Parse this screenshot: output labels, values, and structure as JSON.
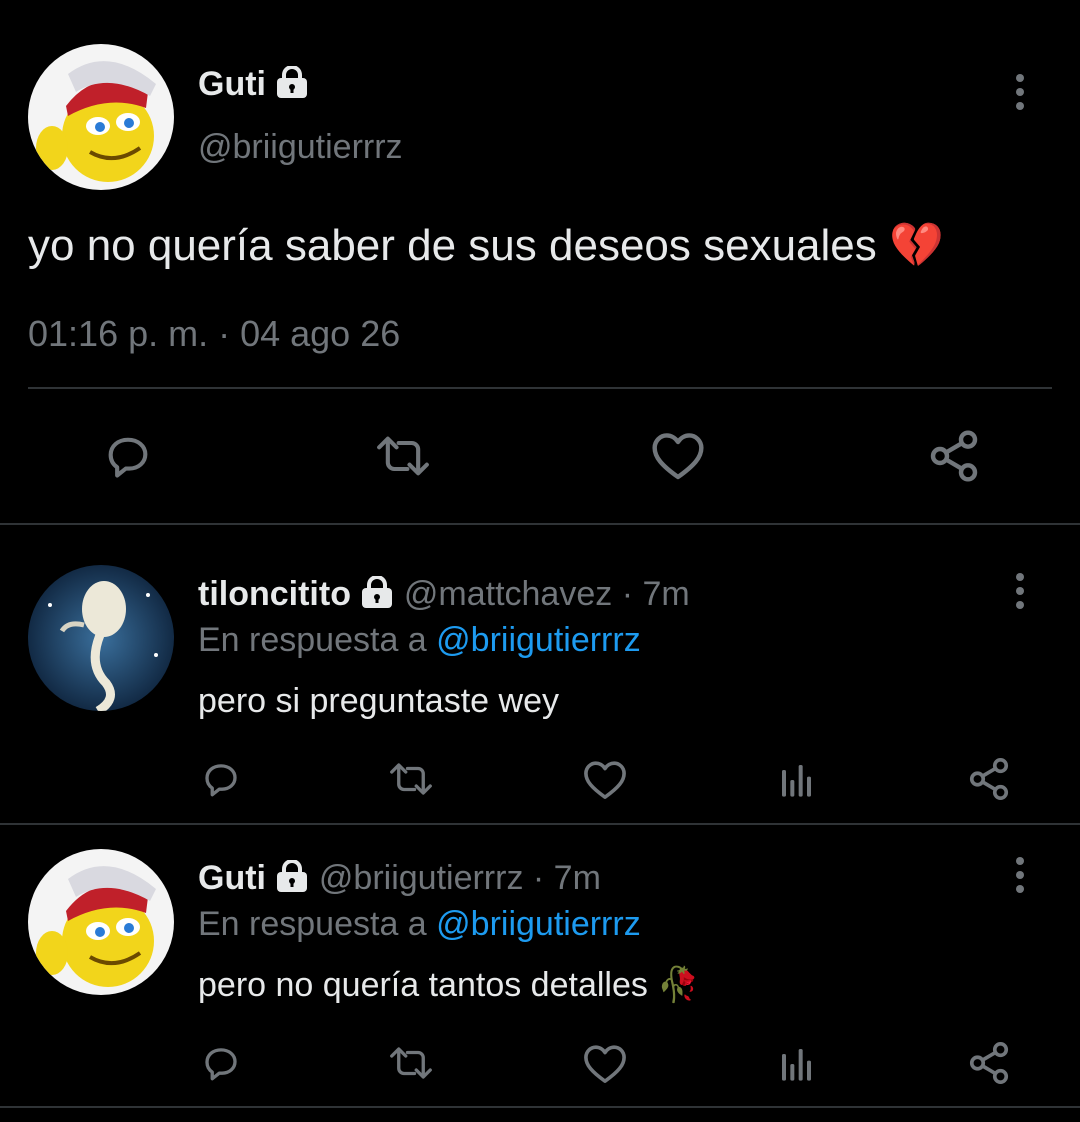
{
  "main_tweet": {
    "author_name": "Guti",
    "handle": "@briigutierrrz",
    "text": "yo no quería saber de sus deseos sexuales",
    "emoji": "💔",
    "timestamp": "01:16 p. m. · 04 ago 26"
  },
  "replies": [
    {
      "author_name": "tiloncitito",
      "handle": "@mattchavez",
      "age": "· 7m",
      "reply_prefix": "En respuesta a",
      "reply_to": "@briigutierrrz",
      "text": "pero si preguntaste wey",
      "emoji": ""
    },
    {
      "author_name": "Guti",
      "handle": "@briigutierrrz",
      "age": "· 7m",
      "reply_prefix": "En respuesta a",
      "reply_to": "@briigutierrrz",
      "text": "pero no quería tantos detalles",
      "emoji": "🥀"
    }
  ],
  "colors": {
    "background": "#000000",
    "text": "#e7e9ea",
    "muted": "#71767b",
    "link": "#1d9bf0",
    "divider": "#2f3336"
  },
  "icons": [
    "lock-icon",
    "more-vertical-icon",
    "reply-icon",
    "retweet-icon",
    "like-icon",
    "views-icon",
    "share-icon"
  ]
}
